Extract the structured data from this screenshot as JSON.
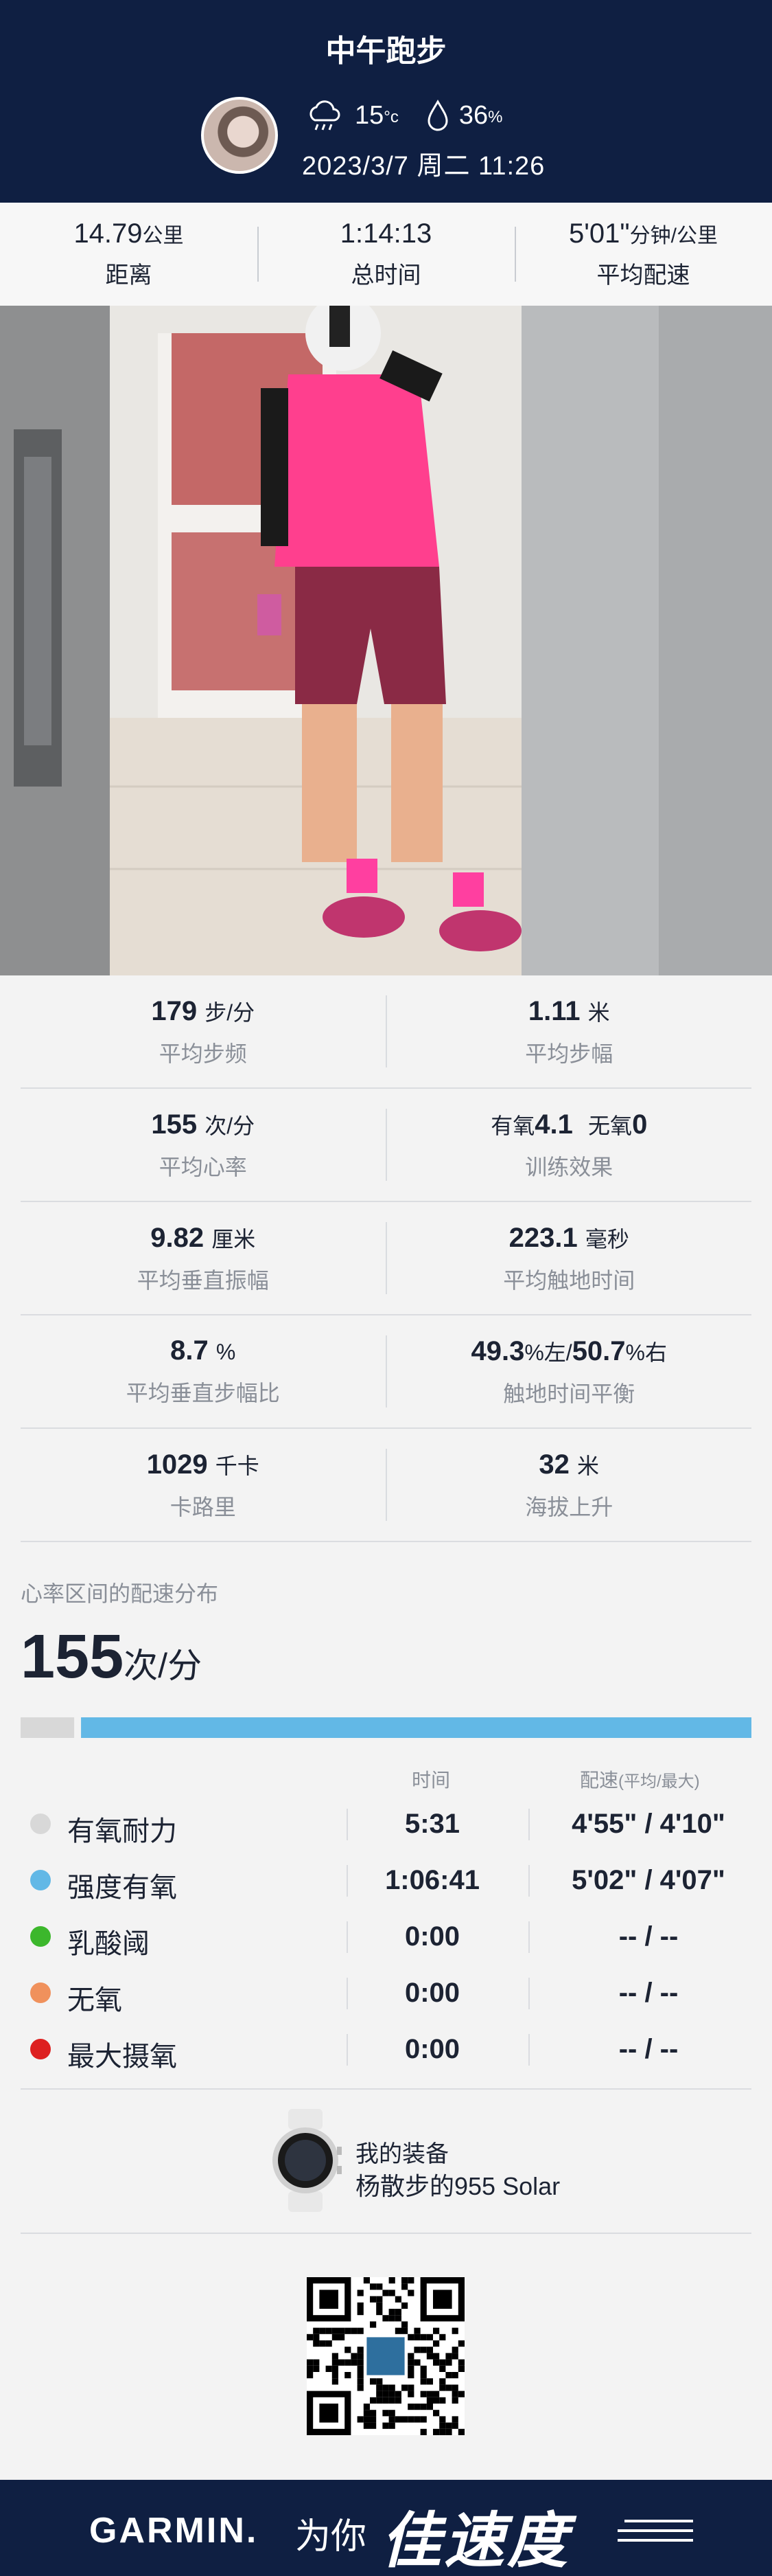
{
  "header": {
    "title": "中午跑步",
    "temperature": "15",
    "temp_unit": "°c",
    "humidity": "36",
    "humidity_unit": "%",
    "datetime": "2023/3/7 周二 11:26"
  },
  "summary": [
    {
      "value": "14.79",
      "unit": "公里",
      "label": "距离"
    },
    {
      "value": "1:14:13",
      "unit": "",
      "label": "总时间"
    },
    {
      "value": "5'01\"",
      "unit": "分钟/公里",
      "label": "平均配速"
    }
  ],
  "stats": {
    "cadence": {
      "value": "179",
      "unit": "步/分",
      "label": "平均步频"
    },
    "stride": {
      "value": "1.11",
      "unit": "米",
      "label": "平均步幅"
    },
    "heart_rate": {
      "value": "155",
      "unit": "次/分",
      "label": "平均心率"
    },
    "training_effect": {
      "aerobic_label": "有氧",
      "aerobic_value": "4.1",
      "anaerobic_label": "无氧",
      "anaerobic_value": "0",
      "label": "训练效果"
    },
    "vertical_osc": {
      "value": "9.82",
      "unit": "厘米",
      "label": "平均垂直振幅"
    },
    "ground_contact": {
      "value": "223.1",
      "unit": "毫秒",
      "label": "平均触地时间"
    },
    "vertical_ratio": {
      "value": "8.7",
      "unit": "%",
      "label": "平均垂直步幅比"
    },
    "gct_balance": {
      "left_value": "49.3",
      "left_unit": "%左/",
      "right_value": "50.7",
      "right_unit": "%右",
      "label": "触地时间平衡"
    },
    "calories": {
      "value": "1029",
      "unit": "千卡",
      "label": "卡路里"
    },
    "elevation": {
      "value": "32",
      "unit": "米",
      "label": "海拔上升"
    }
  },
  "hr_zones": {
    "title": "心率区间的配速分布",
    "avg_hr": "155",
    "avg_hr_unit": "次/分",
    "col_time": "时间",
    "col_pace": "配速",
    "col_pace_note": "(平均/最大)",
    "bar_fractions": [
      0.074,
      0.926,
      0,
      0,
      0
    ],
    "zones": [
      {
        "name": "有氧耐力",
        "time": "5:31",
        "pace": "4'55\" / 4'10\"",
        "color": "#d8d8d8"
      },
      {
        "name": "强度有氧",
        "time": "1:06:41",
        "pace": "5'02\" / 4'07\"",
        "color": "#62b8e6"
      },
      {
        "name": "乳酸阈",
        "time": "0:00",
        "pace": "-- / --",
        "color": "#3cb72c"
      },
      {
        "name": "无氧",
        "time": "0:00",
        "pace": "-- / --",
        "color": "#f0915c"
      },
      {
        "name": "最大摄氧",
        "time": "0:00",
        "pace": "-- / --",
        "color": "#dd2020"
      }
    ]
  },
  "device": {
    "label": "我的装备",
    "name": "杨散步的955 Solar"
  },
  "footer": {
    "brand": "GARMIN.",
    "for": "为你",
    "slogan": "佳速度"
  },
  "colors": {
    "header_bg": "#0f1f42",
    "text_dark": "#1c2333",
    "text_gray": "#8a8f98"
  }
}
